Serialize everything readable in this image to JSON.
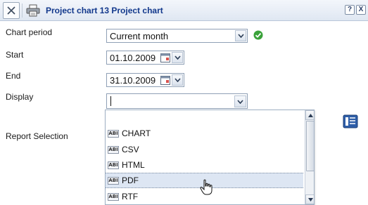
{
  "window": {
    "title": "Project chart 13 Project chart",
    "help_label": "?",
    "close_label": "X"
  },
  "form": {
    "chart_period": {
      "label": "Chart period",
      "value": "Current month"
    },
    "start": {
      "label": "Start",
      "value": "01.10.2009"
    },
    "end": {
      "label": "End",
      "value": "31.10.2009"
    },
    "display": {
      "label": "Display",
      "value": ""
    },
    "report_selection": {
      "label": "Report Selection"
    }
  },
  "dropdown": {
    "options": [
      {
        "label": "",
        "selected": false
      },
      {
        "label": "CHART",
        "selected": false
      },
      {
        "label": "CSV",
        "selected": false
      },
      {
        "label": "HTML",
        "selected": false
      },
      {
        "label": "PDF",
        "selected": true
      },
      {
        "label": "RTF",
        "selected": false
      }
    ],
    "icon_text": "ABI"
  },
  "colors": {
    "title_text": "#12388c",
    "selected_row": "#dde6f3",
    "ok_green": "#3aa23a"
  },
  "icons": [
    "close-icon",
    "print-icon",
    "help-icon",
    "check-ok-icon",
    "calendar-icon",
    "chevron-down-icon",
    "report-list-icon",
    "hand-pointer-icon"
  ]
}
